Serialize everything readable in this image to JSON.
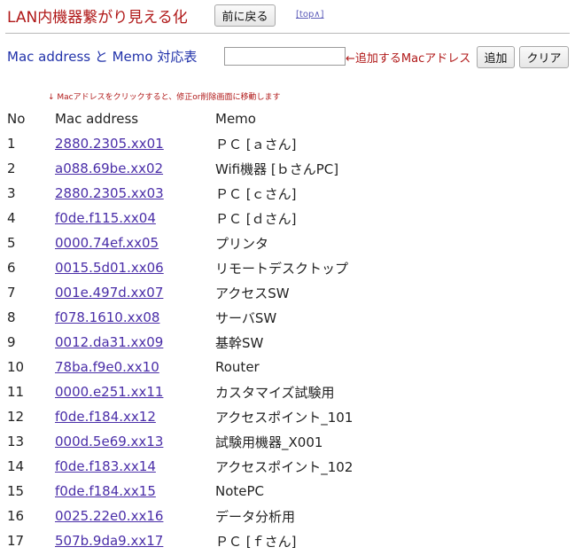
{
  "header": {
    "title": "LAN内機器繋がり見える化",
    "back_button": "前に戻る",
    "top_link": "[top∧]"
  },
  "form": {
    "table_title": "Mac address と Memo 対応表",
    "input_value": "",
    "input_hint": "←追加するMacアドレス",
    "add_button": "追加",
    "clear_button": "クリア"
  },
  "note": "↓ Macアドレスをクリックすると、修正or削除画面に移動します",
  "table": {
    "headers": {
      "no": "No",
      "mac": "Mac address",
      "memo": "Memo"
    },
    "rows": [
      {
        "no": "1",
        "mac": "2880.2305.xx01",
        "memo": "ＰＣ [ａさん]"
      },
      {
        "no": "2",
        "mac": "a088.69be.xx02",
        "memo": "Wifi機器 [ｂさんPC]"
      },
      {
        "no": "3",
        "mac": "2880.2305.xx03",
        "memo": "ＰＣ [ｃさん]"
      },
      {
        "no": "4",
        "mac": "f0de.f115.xx04",
        "memo": "ＰＣ [ｄさん]"
      },
      {
        "no": "5",
        "mac": "0000.74ef.xx05",
        "memo": "プリンタ"
      },
      {
        "no": "6",
        "mac": "0015.5d01.xx06",
        "memo": "リモートデスクトップ"
      },
      {
        "no": "7",
        "mac": "001e.497d.xx07",
        "memo": "アクセスSW"
      },
      {
        "no": "8",
        "mac": "f078.1610.xx08",
        "memo": "サーバSW"
      },
      {
        "no": "9",
        "mac": "0012.da31.xx09",
        "memo": "基幹SW"
      },
      {
        "no": "10",
        "mac": "78ba.f9e0.xx10",
        "memo": "Router"
      },
      {
        "no": "11",
        "mac": "0000.e251.xx11",
        "memo": "カスタマイズ試験用"
      },
      {
        "no": "12",
        "mac": "f0de.f184.xx12",
        "memo": "アクセスポイント_101"
      },
      {
        "no": "13",
        "mac": "000d.5e69.xx13",
        "memo": "試験用機器_X001"
      },
      {
        "no": "14",
        "mac": "f0de.f183.xx14",
        "memo": "アクセスポイント_102"
      },
      {
        "no": "15",
        "mac": "f0de.f184.xx15",
        "memo": "NotePC"
      },
      {
        "no": "16",
        "mac": "0025.22e0.xx16",
        "memo": "データ分析用"
      },
      {
        "no": "17",
        "mac": "507b.9da9.xx17",
        "memo": "ＰＣ [ｆさん]"
      }
    ]
  }
}
